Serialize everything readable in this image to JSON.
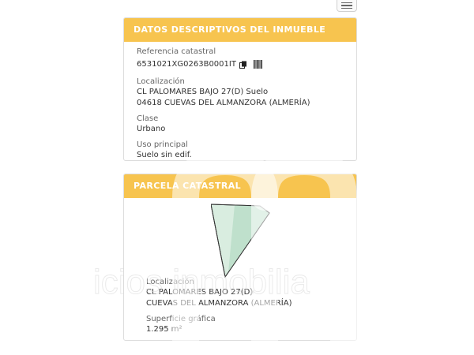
{
  "menu": {
    "icon": "hamburger-menu-icon"
  },
  "descriptive": {
    "header": "DATOS DESCRIPTIVOS DEL INMUEBLE",
    "ref_label": "Referencia catastral",
    "ref_value": "6531021XG0263B0001IT",
    "copy_icon": "copy-icon",
    "barcode_icon": "barcode-icon",
    "loc_label": "Localización",
    "loc_line1": "CL PALOMARES BAJO 27(D) Suelo",
    "loc_line2": "04618 CUEVAS DEL ALMANZORA (ALMERÍA)",
    "clase_label": "Clase",
    "clase_value": "Urbano",
    "uso_label": "Uso principal",
    "uso_value": "Suelo sin edif."
  },
  "parcel": {
    "header": "PARCELA CATASTRAL",
    "loc_label": "Localización",
    "loc_line1": "CL PALOMARES BAJO 27(D)",
    "loc_line2": "CUEVAS DEL ALMANZORA (ALMERÍA)",
    "surface_label": "Superficie gráfica",
    "surface_value": "1.295 m²",
    "shape_fill": "#cfe8d8"
  },
  "watermark": {
    "text": "icios inmobilia"
  },
  "colors": {
    "header_bg": "#f7c44f",
    "header_text": "#ffffff"
  }
}
